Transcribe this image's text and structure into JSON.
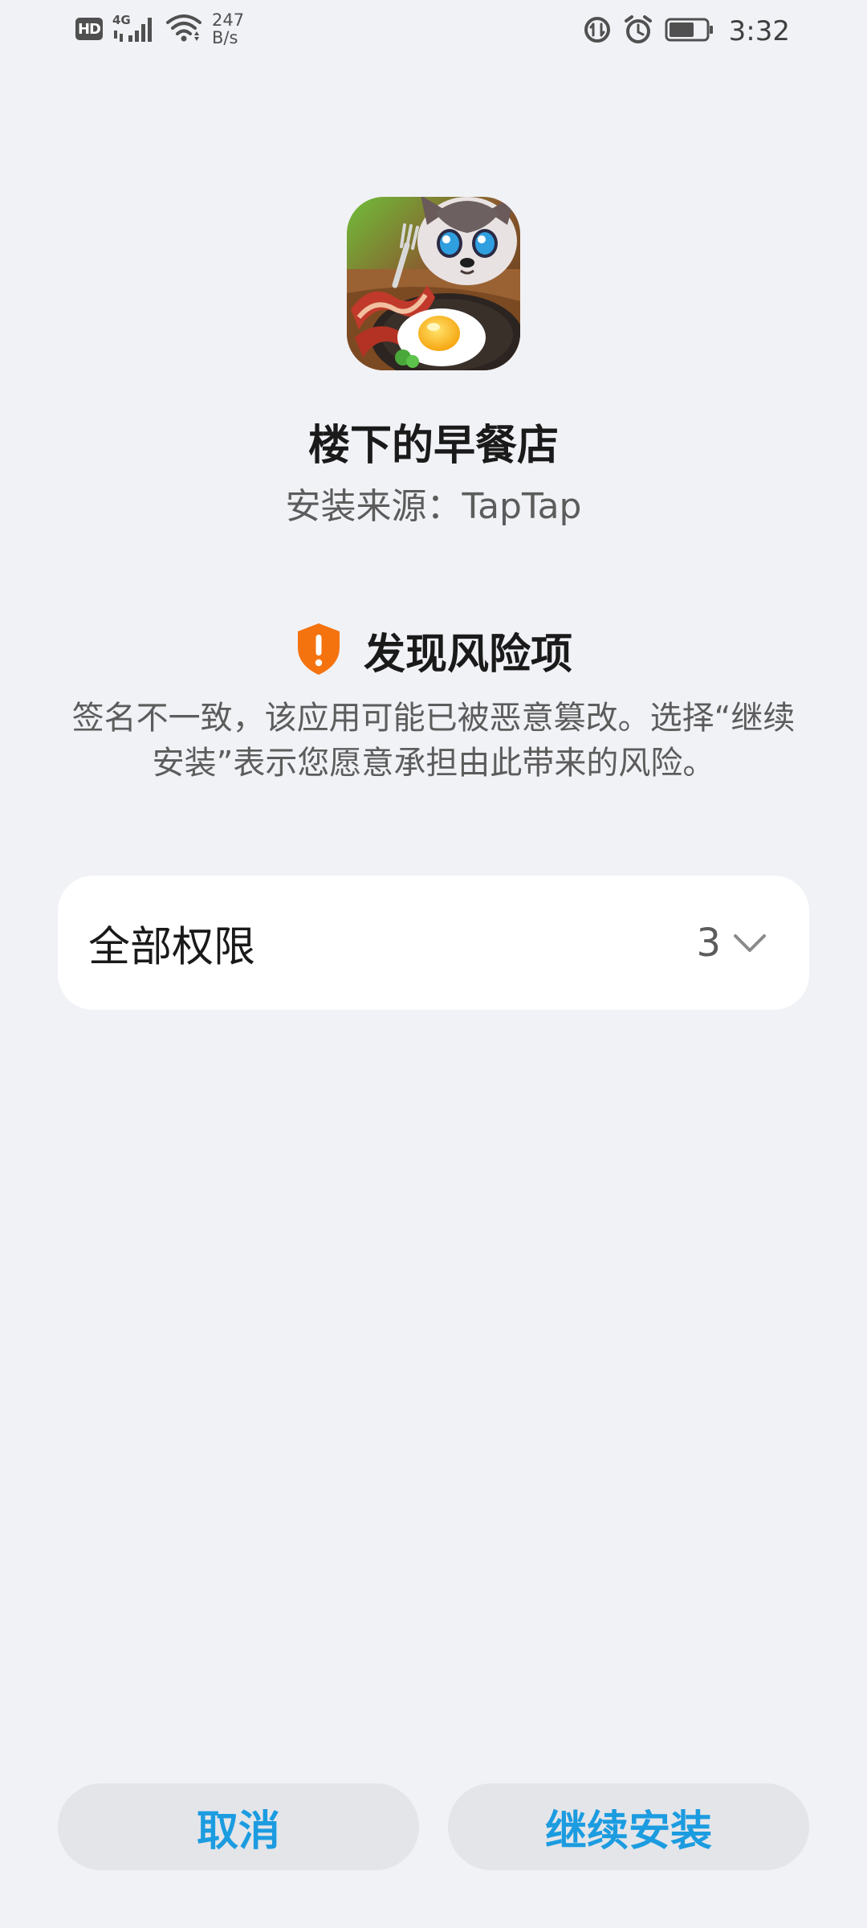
{
  "status_bar": {
    "hd_label": "HD",
    "network_type": "4G",
    "speed_value": "247",
    "speed_unit": "B/s",
    "time": "3:32",
    "icons": [
      "hd-icon",
      "signal-icon",
      "wifi-icon",
      "data-saver-icon",
      "alarm-icon",
      "battery-icon"
    ]
  },
  "app": {
    "icon_name": "app-icon",
    "name": "楼下的早餐店",
    "install_source": "安装来源：TapTap"
  },
  "risk": {
    "icon_name": "shield-warning-icon",
    "title": "发现风险项",
    "description": "签名不一致，该应用可能已被恶意篡改。选择“继续安装”表示您愿意承担由此带来的风险。",
    "accent_color": "#f5730f"
  },
  "permissions": {
    "label": "全部权限",
    "count": "3",
    "expand_icon": "chevron-down-icon"
  },
  "buttons": {
    "cancel_label": "取消",
    "continue_label": "继续安装",
    "accent_color": "#1c9ce0"
  }
}
